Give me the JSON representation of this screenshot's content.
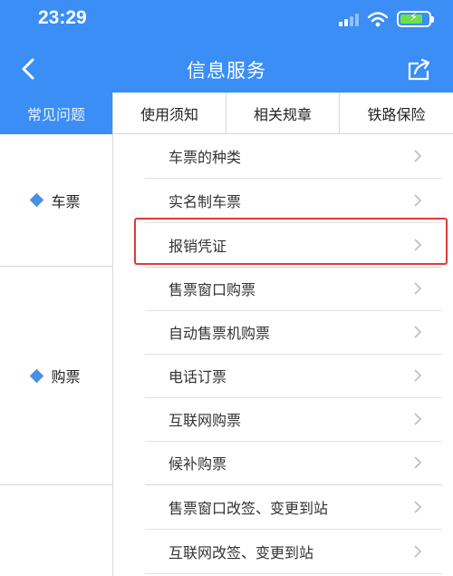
{
  "status_bar": {
    "time": "23:29"
  },
  "header": {
    "title": "信息服务"
  },
  "tabs": [
    {
      "label": "常见问题",
      "active": true
    },
    {
      "label": "使用须知",
      "active": false
    },
    {
      "label": "相关规章",
      "active": false
    },
    {
      "label": "铁路保险",
      "active": false
    }
  ],
  "categories": [
    {
      "label": "车票",
      "items": [
        "车票的种类",
        "实名制车票",
        "报销凭证"
      ]
    },
    {
      "label": "购票",
      "items": [
        "售票窗口购票",
        "自动售票机购票",
        "电话订票",
        "互联网购票",
        "候补购票"
      ]
    },
    {
      "label": "",
      "items": [
        "售票窗口改签、变更到站",
        "互联网改签、变更到站"
      ]
    }
  ],
  "highlighted_item": "报销凭证",
  "colors": {
    "accent": "#3a8ef6",
    "highlight": "#e03a3a",
    "diamond": "#4a90e2"
  }
}
